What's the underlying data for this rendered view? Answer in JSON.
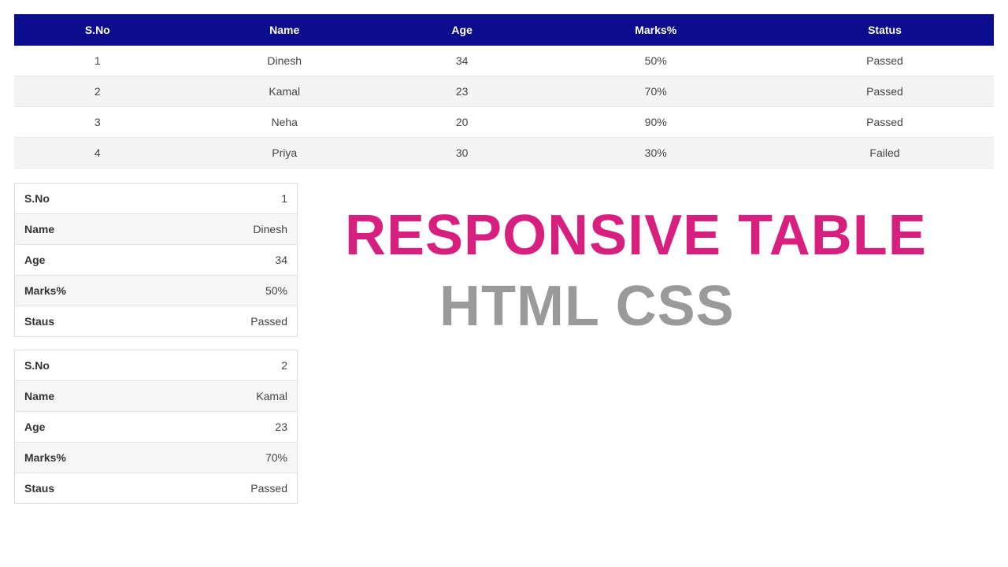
{
  "table": {
    "headers": [
      "S.No",
      "Name",
      "Age",
      "Marks%",
      "Status"
    ],
    "rows": [
      {
        "sno": "1",
        "name": "Dinesh",
        "age": "34",
        "marks": "50%",
        "status": "Passed"
      },
      {
        "sno": "2",
        "name": "Kamal",
        "age": "23",
        "marks": "70%",
        "status": "Passed"
      },
      {
        "sno": "3",
        "name": "Neha",
        "age": "20",
        "marks": "90%",
        "status": "Passed"
      },
      {
        "sno": "4",
        "name": "Priya",
        "age": "30",
        "marks": "30%",
        "status": "Failed"
      }
    ]
  },
  "card_labels": {
    "sno": "S.No",
    "name": "Name",
    "age": "Age",
    "marks": "Marks%",
    "status": "Staus"
  },
  "cards": [
    {
      "sno": "1",
      "name": "Dinesh",
      "age": "34",
      "marks": "50%",
      "status": "Passed"
    },
    {
      "sno": "2",
      "name": "Kamal",
      "age": "23",
      "marks": "70%",
      "status": "Passed"
    }
  ],
  "headline": {
    "line1": "RESPONSIVE TABLE",
    "line2": "HTML CSS"
  }
}
